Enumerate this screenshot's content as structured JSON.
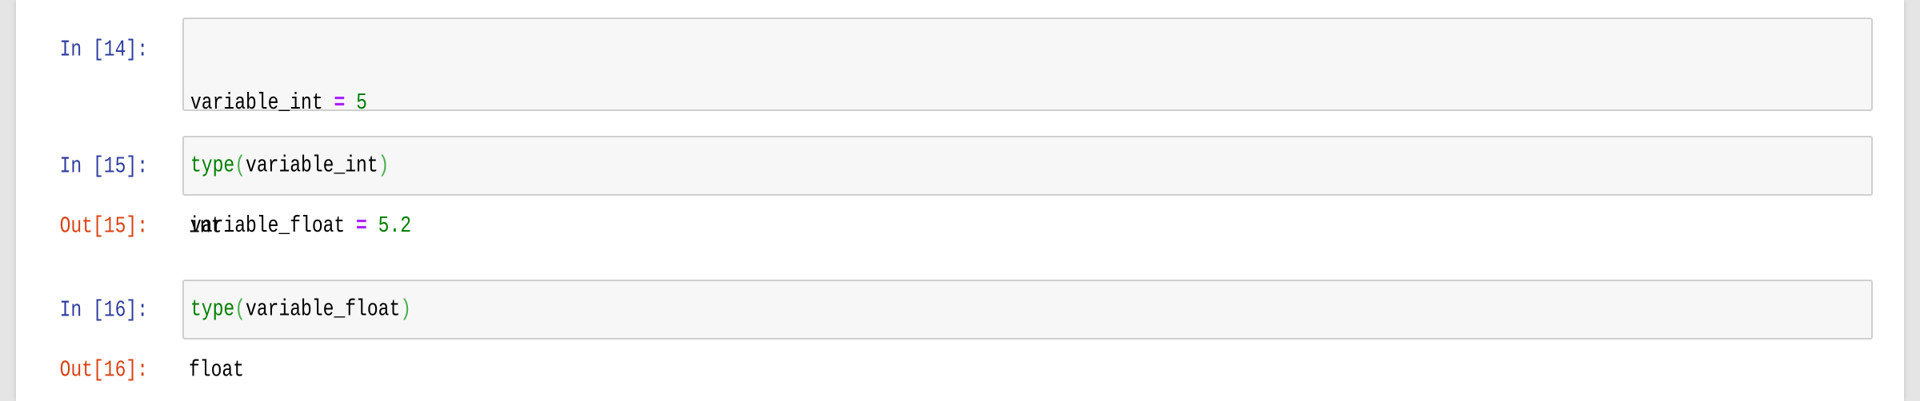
{
  "cells": [
    {
      "prompt": "In [14]:",
      "lines": [
        {
          "name": "variable_int",
          "op": "=",
          "value": "5"
        },
        {
          "name": "variable_float",
          "op": "=",
          "value": "5.2"
        }
      ]
    },
    {
      "prompt": "In [15]:",
      "func": "type",
      "open": "(",
      "arg": "variable_int",
      "close": ")",
      "out_prompt": "Out[15]:",
      "output": "int"
    },
    {
      "prompt": "In [16]:",
      "func": "type",
      "open": "(",
      "arg": "variable_float",
      "close": ")",
      "out_prompt": "Out[16]:",
      "output": "float"
    }
  ],
  "colors": {
    "in_prompt": "#303F9F",
    "out_prompt": "#D84315",
    "operator": "#AA22FF",
    "number": "#008000"
  }
}
